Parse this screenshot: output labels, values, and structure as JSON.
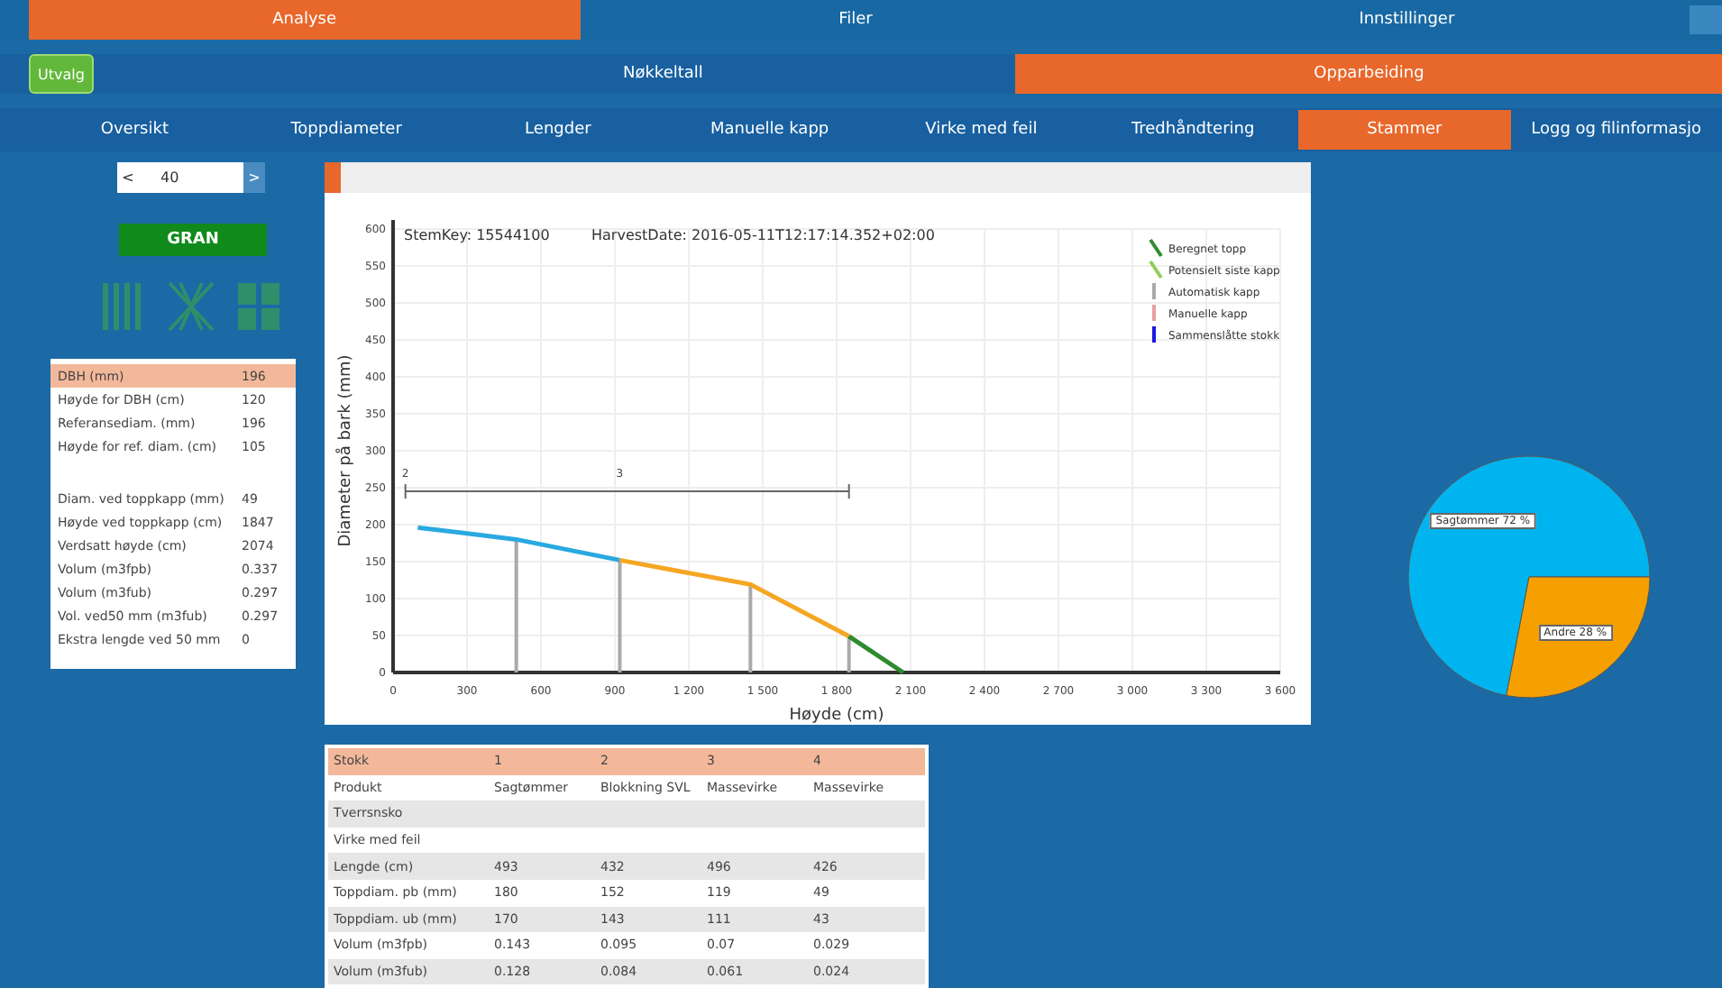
{
  "main_tabs": [
    {
      "label": "Analyse",
      "selected": true
    },
    {
      "label": "Filer",
      "selected": false
    },
    {
      "label": "Innstillinger",
      "selected": false
    }
  ],
  "filter_button": {
    "label": "Utvalg"
  },
  "section_tabs": [
    {
      "label": "Nøkkeltall",
      "selected": false
    },
    {
      "label": "Opparbeiding",
      "selected": true
    }
  ],
  "sub_tabs": [
    {
      "label": "Oversikt",
      "selected": false
    },
    {
      "label": "Toppdiameter",
      "selected": false
    },
    {
      "label": "Lengder",
      "selected": false
    },
    {
      "label": "Manuelle kapp",
      "selected": false
    },
    {
      "label": "Virke med feil",
      "selected": false
    },
    {
      "label": "Tredhåndtering",
      "selected": false
    },
    {
      "label": "Stammer",
      "selected": true
    },
    {
      "label": "Logg og filinformasjo",
      "selected": false
    }
  ],
  "stem_picker": {
    "prev": "<",
    "value": "40",
    "next": ">"
  },
  "species_button": {
    "label": "GRAN"
  },
  "stem_info": {
    "groups": [
      [
        {
          "label": "DBH (mm)",
          "value": "196",
          "selected": true
        },
        {
          "label": "Høyde for DBH (cm)",
          "value": "120",
          "selected": false
        },
        {
          "label": "Referansediam. (mm)",
          "value": "196",
          "selected": false
        },
        {
          "label": "Høyde for ref. diam. (cm)",
          "value": "105",
          "selected": false
        }
      ],
      [
        {
          "label": "Diam. ved toppkapp (mm)",
          "value": "49",
          "selected": false
        },
        {
          "label": "Høyde ved toppkapp (cm)",
          "value": "1847",
          "selected": false
        },
        {
          "label": "Verdsatt høyde (cm)",
          "value": "2074",
          "selected": false
        },
        {
          "label": "Volum (m3fpb)",
          "value": "0.337",
          "selected": false
        },
        {
          "label": "Volum (m3fub)",
          "value": "0.297",
          "selected": false
        },
        {
          "label": "Vol. ved50 mm (m3fub)",
          "value": "0.297",
          "selected": false
        },
        {
          "label": "Ekstra lengde ved 50 mm",
          "value": "0",
          "selected": false
        }
      ]
    ]
  },
  "profile_chart": {
    "stem_key": "StemKey: 15544100",
    "harvest_date": "HarvestDate: 2016-05-11T12:17:14.352+02:00",
    "legend": [
      {
        "label": "Beregnet topp",
        "color": "#2e8b2e"
      },
      {
        "label": "Potensielt siste kapp",
        "color": "#8fce5a"
      },
      {
        "label": "Automatisk kapp",
        "color": "#aaaaaa"
      },
      {
        "label": "Manuelle kapp",
        "color": "#e8a0a0"
      },
      {
        "label": "Sammenslåtte stokk",
        "color": "#1a1ae0"
      }
    ],
    "chart_data": {
      "type": "line",
      "xlabel": "Høyde (cm)",
      "ylabel": "Diameter på bark (mm)",
      "grid": true,
      "ref_lines": [
        {
          "axis": "x",
          "value": 500
        },
        {
          "axis": "x",
          "value": 920
        },
        {
          "axis": "x",
          "value": 1450
        },
        {
          "axis": "x",
          "value": 1850
        }
      ],
      "x": [
        100,
        500,
        920,
        1450,
        1850,
        2070
      ],
      "series": [
        {
          "color": "#29a9e0",
          "values": [
            196,
            180,
            152,
            null,
            null,
            null
          ]
        },
        {
          "color": "#f5a623",
          "values": [
            null,
            null,
            152,
            119,
            49,
            null
          ]
        },
        {
          "color": "#2e8b2e",
          "values": [
            null,
            null,
            null,
            null,
            49,
            0
          ]
        }
      ],
      "xlim": [
        0,
        3600
      ],
      "ylim": [
        0,
        600
      ],
      "xticks": [
        0,
        300,
        600,
        900,
        {
          "value": 1200,
          "label": "1 200"
        },
        {
          "value": 1500,
          "label": "1 500"
        },
        {
          "value": 1800,
          "label": "1 800"
        },
        {
          "value": 2100,
          "label": "2 100"
        },
        {
          "value": 2400,
          "label": "2 400"
        },
        {
          "value": 2700,
          "label": "2 700"
        },
        {
          "value": 3000,
          "label": "3 000"
        },
        {
          "value": 3300,
          "label": "3 300"
        },
        {
          "value": 3600,
          "label": "3 600"
        }
      ],
      "yticks": [
        0,
        50,
        100,
        150,
        200,
        250,
        300,
        350,
        400,
        450,
        500,
        550,
        600
      ],
      "annotations": [
        "2",
        "3"
      ]
    }
  },
  "log_table": {
    "columns": [
      "Stokk",
      "1",
      "2",
      "3",
      "4"
    ],
    "rows": [
      [
        "Produkt",
        "Sagtømmer",
        "Blokkning SVL",
        "Massevirke",
        "Massevirke"
      ],
      [
        "Tverrsnsko",
        "",
        "",
        "",
        ""
      ],
      [
        "Virke med feil",
        "",
        "",
        "",
        ""
      ],
      [
        "Lengde (cm)",
        "493",
        "432",
        "496",
        "426"
      ],
      [
        "Toppdiam. pb (mm)",
        "180",
        "152",
        "119",
        "49"
      ],
      [
        "Toppdiam. ub (mm)",
        "170",
        "143",
        "111",
        "43"
      ],
      [
        "Volum (m3fpb)",
        "0.143",
        "0.095",
        "0.07",
        "0.029"
      ],
      [
        "Volum (m3fub)",
        "0.128",
        "0.084",
        "0.061",
        "0.024"
      ]
    ]
  },
  "product_pie": {
    "chart_data": {
      "type": "pie",
      "categories": [
        "Sagtømmer 72 %",
        "Andre 28 %"
      ],
      "values": [
        72,
        28
      ],
      "colors": [
        "#00b4f0",
        "#f5a000"
      ]
    }
  }
}
